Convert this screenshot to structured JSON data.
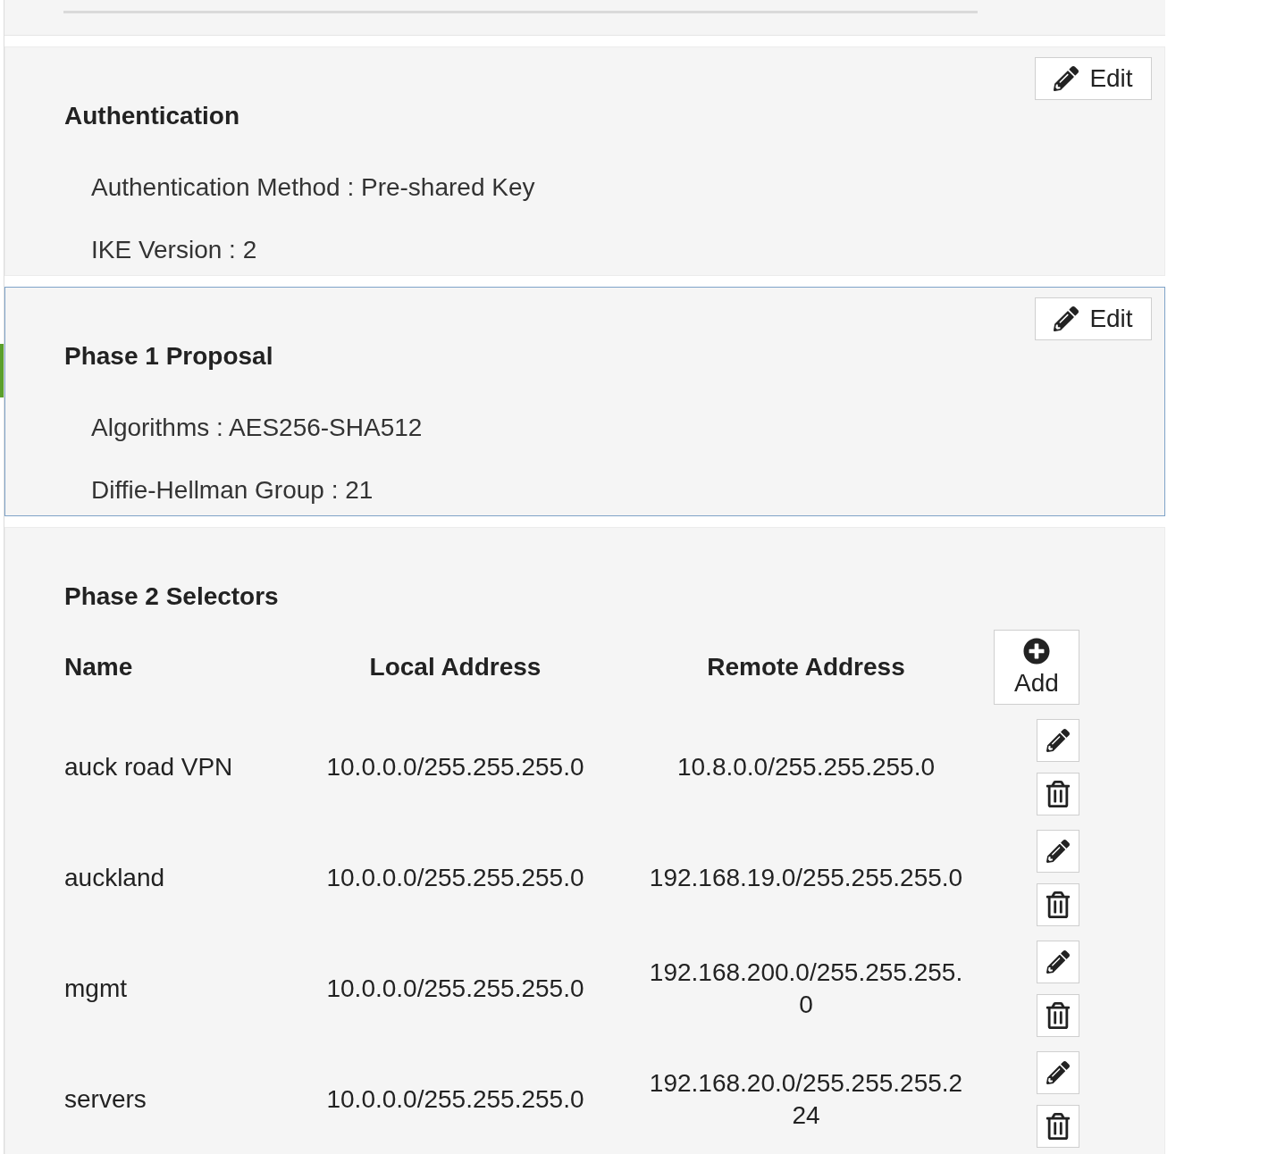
{
  "sections": [
    {
      "kind": "fields",
      "title": "Authentication",
      "highlighted": false,
      "edit_label": "Edit",
      "fields": [
        "Authentication Method : Pre-shared Key",
        "IKE Version : 2"
      ]
    },
    {
      "kind": "fields",
      "title": "Phase 1 Proposal",
      "highlighted": true,
      "edit_label": "Edit",
      "fields": [
        "Algorithms : AES256-SHA512",
        "Diffie-Hellman Group : 21"
      ]
    },
    {
      "kind": "table",
      "title": "Phase 2 Selectors",
      "highlighted": false,
      "columns": [
        "Name",
        "Local Address",
        "Remote Address"
      ],
      "add_label": "Add",
      "rows": [
        {
          "name": "auck road VPN",
          "local": "10.0.0.0/255.255.255.0",
          "remote": "10.8.0.0/255.255.255.0"
        },
        {
          "name": "auckland",
          "local": "10.0.0.0/255.255.255.0",
          "remote": "192.168.19.0/255.255.255.0"
        },
        {
          "name": "mgmt",
          "local": "10.0.0.0/255.255.255.0",
          "remote": "192.168.200.0/255.255.255.0"
        },
        {
          "name": "servers",
          "local": "10.0.0.0/255.255.255.0",
          "remote": "192.168.20.0/255.255.255.224"
        }
      ]
    }
  ]
}
